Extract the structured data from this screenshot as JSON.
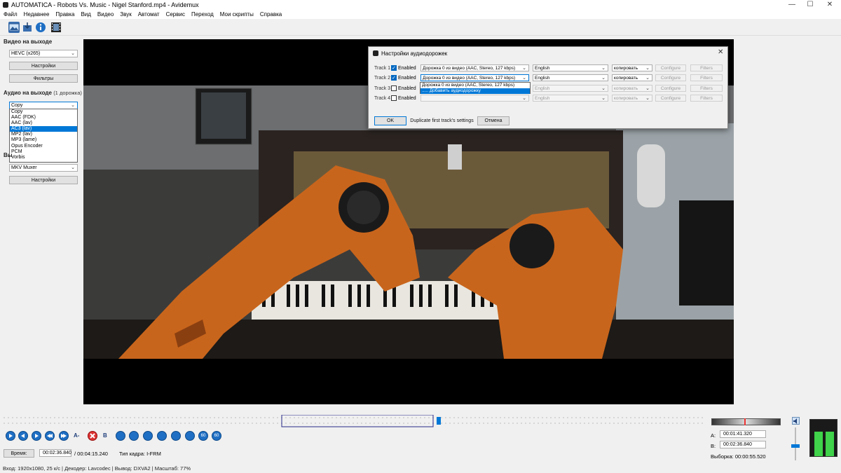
{
  "window": {
    "title": "AUTOMATICA - Robots Vs. Music - Nigel Stanford.mp4 - Avidemux",
    "minimize": "—",
    "maximize": "☐",
    "close": "✕"
  },
  "menu": [
    "Файл",
    "Недавнее",
    "Правка",
    "Вид",
    "Видео",
    "Звук",
    "Автомат",
    "Сервис",
    "Переход",
    "Мои скрипты",
    "Справка"
  ],
  "left": {
    "video_out_title": "Видео на выходе",
    "video_codec": "HEVC (x265)",
    "settings_btn": "Настройки",
    "filters_btn": "Фильтры",
    "audio_out_title": "Аудио на выходе",
    "audio_tracks": "(1 дорожка)",
    "audio_codec": "Copy",
    "audio_options": [
      "Copy",
      "AAC (FDK)",
      "AAC (lav)",
      "AC3 (lav)",
      "MP2 (lav)",
      "MP3 (lame)",
      "Opus Encoder",
      "PCM",
      "Vorbis"
    ],
    "audio_selected_index": 3,
    "output_label_partial": "Вы",
    "muxer": "MKV Muxer",
    "muxer_settings_btn": "Настройки"
  },
  "dialog": {
    "title": "Настройки аудиодорожек",
    "enabled_label": "Enabled",
    "tracks": [
      {
        "label": "Track 1",
        "enabled": true,
        "source": "Дорожка 0 из видео (AAC, Stereo, 127 kbps)",
        "lang": "English",
        "codec": "копировать",
        "configure": "Configure",
        "filters": "Filters"
      },
      {
        "label": "Track 2",
        "enabled": true,
        "source": "Дорожка 0 из видео (AAC, Stereo, 127 kbps)",
        "lang": "English",
        "codec": "копировать",
        "configure": "Configure",
        "filters": "Filters"
      },
      {
        "label": "Track 3",
        "enabled": false,
        "source": "",
        "lang": "English",
        "codec": "копировать",
        "configure": "Configure",
        "filters": "Filters"
      },
      {
        "label": "Track 4",
        "enabled": false,
        "source": "",
        "lang": "English",
        "codec": "копировать",
        "configure": "Configure",
        "filters": "Filters"
      }
    ],
    "source_options": [
      "Дорожка 0 из видео (AAC, Stereo, 127 kbps)",
      "..... Добавить аудиодорожку"
    ],
    "source_selected_index": 1,
    "ok_btn": "OK",
    "duplicate_btn": "Duplicate first track's settings",
    "cancel_btn": "Отмена"
  },
  "bottom": {
    "time_label": "Время:",
    "current_time": "00:02:36.840",
    "total_time": "/ 00:04:15.240",
    "frame_type": "Тип кадра:  I-FRM",
    "a_label": "A:",
    "a_time": "00:01:41.320",
    "b_label": "B:",
    "b_time": "00:02:36.840",
    "selection": "Выборка: 00:00:55.520",
    "nav_buttons": [
      "play",
      "prev-frame",
      "next-frame",
      "prev-keyframe",
      "next-keyframe",
      "A-",
      "clear-markers",
      "B",
      "go-A",
      "go-B",
      "prev-black",
      "next-black",
      "go-start",
      "go-end",
      "back-60",
      "fwd-60"
    ],
    "nav_labels": [
      "A-",
      "B",
      "60",
      "60"
    ]
  },
  "status": {
    "text": "Вход: 1920x1080, 25 к/с  |  Декодер: Lavcodec  |  Вывод: DXVA2  |  Масштаб: 77%"
  },
  "colors": {
    "accent": "#0078d7",
    "nav_blue": "#1f6fc4",
    "meter_green": "#3fd24a"
  }
}
